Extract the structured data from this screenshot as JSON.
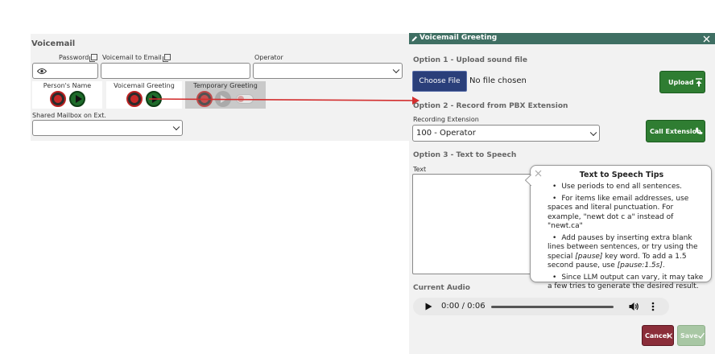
{
  "voicemail": {
    "title": "Voicemail",
    "password_label": "Password",
    "email_label": "Voicemail to Email",
    "operator_label": "Operator",
    "operator_value": "",
    "greetings": [
      {
        "label": "Person's Name"
      },
      {
        "label": "Voicemail Greeting"
      },
      {
        "label": "Temporary Greeting"
      }
    ],
    "shared_label": "Shared Mailbox on Ext.",
    "shared_value": ""
  },
  "dialog": {
    "title": "Voicemail Greeting",
    "option1": "Option 1 - Upload sound file",
    "choose_file": "Choose File",
    "no_file": "No file chosen",
    "upload": "Upload",
    "option2": "Option 2 - Record from PBX Extension",
    "recording_ext_label": "Recording Extension",
    "recording_ext_value": "100 - Operator",
    "call_extension": "Call Extension",
    "option3": "Option 3 - Text to Speech",
    "text_label": "Text",
    "text_value": "",
    "current_audio": "Current Audio",
    "audio_time": "0:00 / 0:06",
    "audio_progress": 0,
    "cancel": "Cancel",
    "save": "Save"
  },
  "tooltip": {
    "title": "Text to Speech Tips",
    "tips": [
      "Use periods to end all sentences.",
      "For items like email addresses, use spaces and literal punctuation. For example, \"newt dot c a\" instead of \"newt.ca\"",
      "Add pauses by inserting extra blank lines between sentences, or try using the special [pause] key word. To add a 1.5 second pause, use [pause:1.5s].",
      "Since LLM output can vary, it may take a few tries to generate the desired result."
    ]
  },
  "colors": {
    "header_bg": "#3f6f63",
    "primary_button": "#2a3f7a",
    "success_button": "#2f7d32",
    "danger_button": "#8b2e3a",
    "arrow": "#d32f2f"
  }
}
